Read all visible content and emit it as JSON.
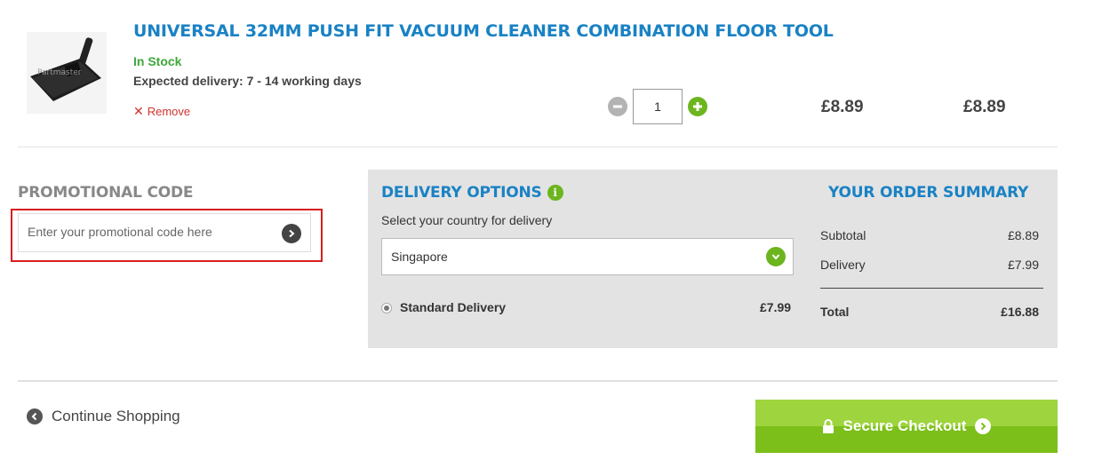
{
  "product": {
    "title": "UNIVERSAL 32MM PUSH FIT VACUUM CLEANER COMBINATION FLOOR TOOL",
    "stock": "In Stock",
    "expected_delivery": "Expected delivery: 7 - 14 working days",
    "remove_label": "Remove",
    "quantity": "1",
    "unit_price": "£8.89",
    "line_total": "£8.89",
    "image_watermark": "Partmaster"
  },
  "promo": {
    "title": "PROMOTIONAL CODE",
    "placeholder": "Enter your promotional code here"
  },
  "delivery": {
    "title": "DELIVERY OPTIONS",
    "select_label": "Select your country for delivery",
    "country": "Singapore",
    "option_label": "Standard Delivery",
    "option_price": "£7.99"
  },
  "summary": {
    "title": "YOUR ORDER SUMMARY",
    "subtotal_label": "Subtotal",
    "subtotal_value": "£8.89",
    "delivery_label": "Delivery",
    "delivery_value": "£7.99",
    "total_label": "Total",
    "total_value": "£16.88"
  },
  "footer": {
    "continue_label": "Continue Shopping",
    "checkout_label": "Secure Checkout"
  },
  "colors": {
    "brand_blue": "#1a82c4",
    "accent_green": "#6cb51f",
    "stock_green": "#3ea83a",
    "remove_red": "#d0332f",
    "highlight_red": "#d81e1e"
  }
}
